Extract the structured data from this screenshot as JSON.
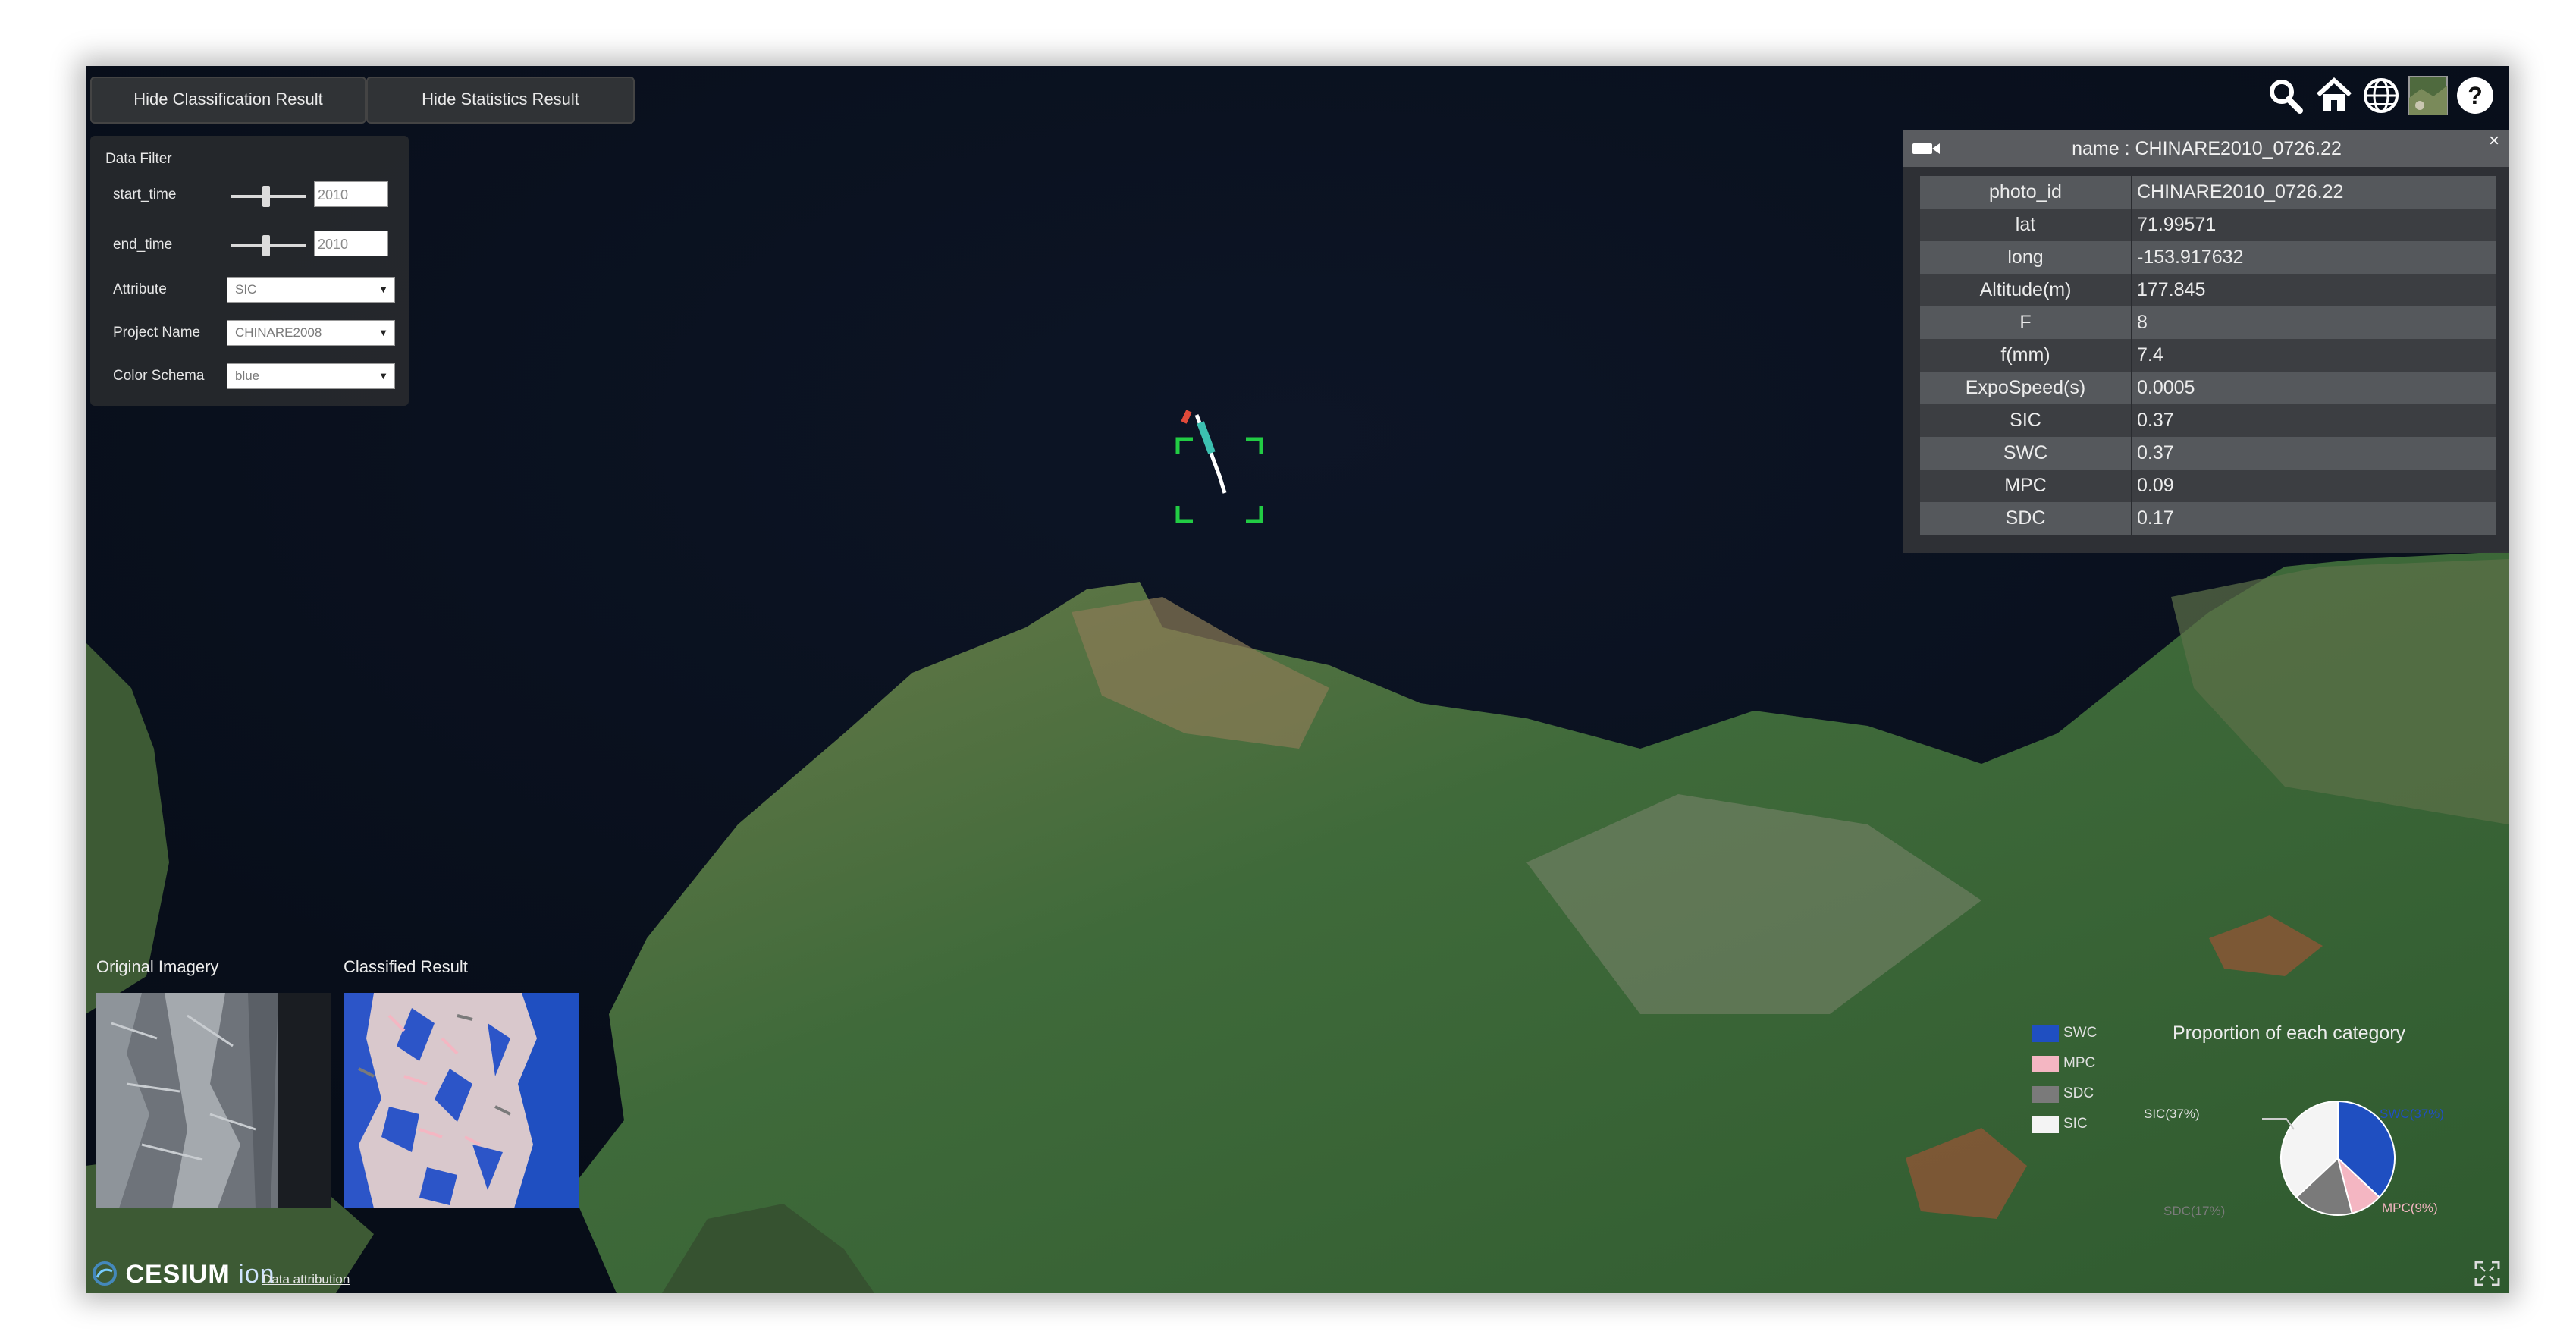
{
  "toolbar": {
    "hide_classification_label": "Hide Classification Result",
    "hide_statistics_label": "Hide Statistics Result"
  },
  "data_filter": {
    "title": "Data Filter",
    "start_time_label": "start_time",
    "start_time_value": "2010",
    "end_time_label": "end_time",
    "end_time_value": "2010",
    "attribute_label": "Attribute",
    "attribute_value": "SIC",
    "project_name_label": "Project Name",
    "project_name_value": "CHINARE2008",
    "color_schema_label": "Color Schema",
    "color_schema_value": "blue"
  },
  "map_tools": [
    "search-icon",
    "home-icon",
    "globe-icon",
    "imagery-layer-icon",
    "help-icon"
  ],
  "info_box": {
    "title": "name : CHINARE2010_0726.22",
    "close_label": "×",
    "rows": [
      {
        "key": "photo_id",
        "value": "CHINARE2010_0726.22"
      },
      {
        "key": "lat",
        "value": "71.99571"
      },
      {
        "key": "long",
        "value": "-153.917632"
      },
      {
        "key": "Altitude(m)",
        "value": "177.845"
      },
      {
        "key": "F",
        "value": "8"
      },
      {
        "key": "f(mm)",
        "value": "7.4"
      },
      {
        "key": "ExpoSpeed(s)",
        "value": "0.0005"
      },
      {
        "key": "SIC",
        "value": "0.37"
      },
      {
        "key": "SWC",
        "value": "0.37"
      },
      {
        "key": "MPC",
        "value": "0.09"
      },
      {
        "key": "SDC",
        "value": "0.17"
      }
    ]
  },
  "thumbnails": {
    "original_label": "Original Imagery",
    "classified_label": "Classified Result"
  },
  "statistics": {
    "title": "Proportion of each category",
    "legend": [
      {
        "label": "SWC",
        "color": "#1f4fc1"
      },
      {
        "label": "MPC",
        "color": "#f4b6c2"
      },
      {
        "label": "SDC",
        "color": "#7a7a7a"
      },
      {
        "label": "SIC",
        "color": "#f4f4f4"
      }
    ],
    "pie_labels": {
      "sic": "SIC(37%)",
      "swc": "SWC(37%)",
      "mpc": "MPC(9%)",
      "sdc": "SDC(17%)"
    }
  },
  "chart_data": {
    "type": "pie",
    "title": "Proportion of each category",
    "categories": [
      "SWC",
      "MPC",
      "SDC",
      "SIC"
    ],
    "values": [
      37,
      9,
      17,
      37
    ],
    "colors": [
      "#1f4fc1",
      "#f4b6c2",
      "#7a7a7a",
      "#f4f4f4"
    ]
  },
  "footer": {
    "logo_text": "CESIUM",
    "logo_suffix": "ion",
    "attribution_label": "Data attribution"
  }
}
